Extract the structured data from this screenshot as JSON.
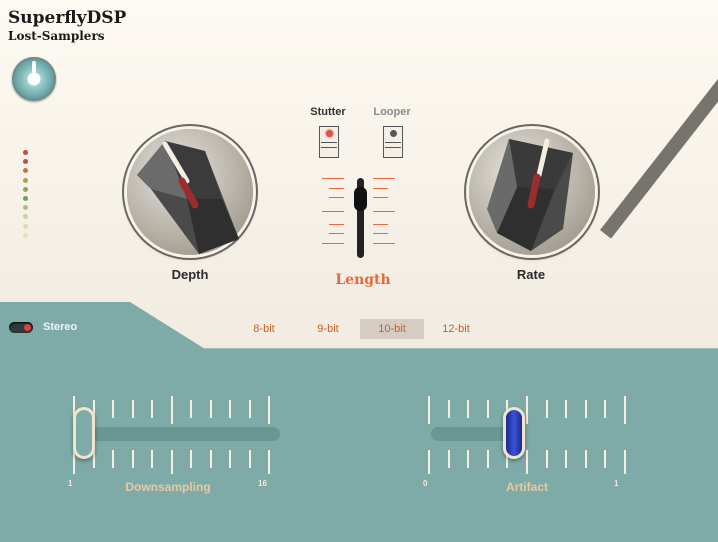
{
  "brand": {
    "name": "SuperflyDSP",
    "product": "Lost-Samplers"
  },
  "leds": [
    "#c94a3e",
    "#c94a3e",
    "#c47a3a",
    "#b89a4a",
    "#8ea45a",
    "#6fa060",
    "#a9c07a",
    "#c8d3a4",
    "#d8ddb4",
    "#e2e0bf"
  ],
  "knobs": {
    "depth": {
      "label": "Depth"
    },
    "rate": {
      "label": "Rate"
    }
  },
  "switches": {
    "stutter": {
      "label": "Stutter",
      "active": true
    },
    "looper": {
      "label": "Looper",
      "active": false
    }
  },
  "length": {
    "label": "Length"
  },
  "stereo": {
    "label": "Stereo",
    "on": true
  },
  "bit_depth": {
    "options": [
      "8-bit",
      "9-bit",
      "10-bit",
      "12-bit"
    ],
    "selected": "10-bit"
  },
  "downsampling": {
    "label": "Downsampling",
    "min": "1",
    "max": "16"
  },
  "artifact": {
    "label": "Artifact",
    "min": "0",
    "max": "1"
  },
  "colors": {
    "accent": "#e8683a",
    "panel": "#7eaba7",
    "artifact_handle": "#2b3ba8"
  }
}
